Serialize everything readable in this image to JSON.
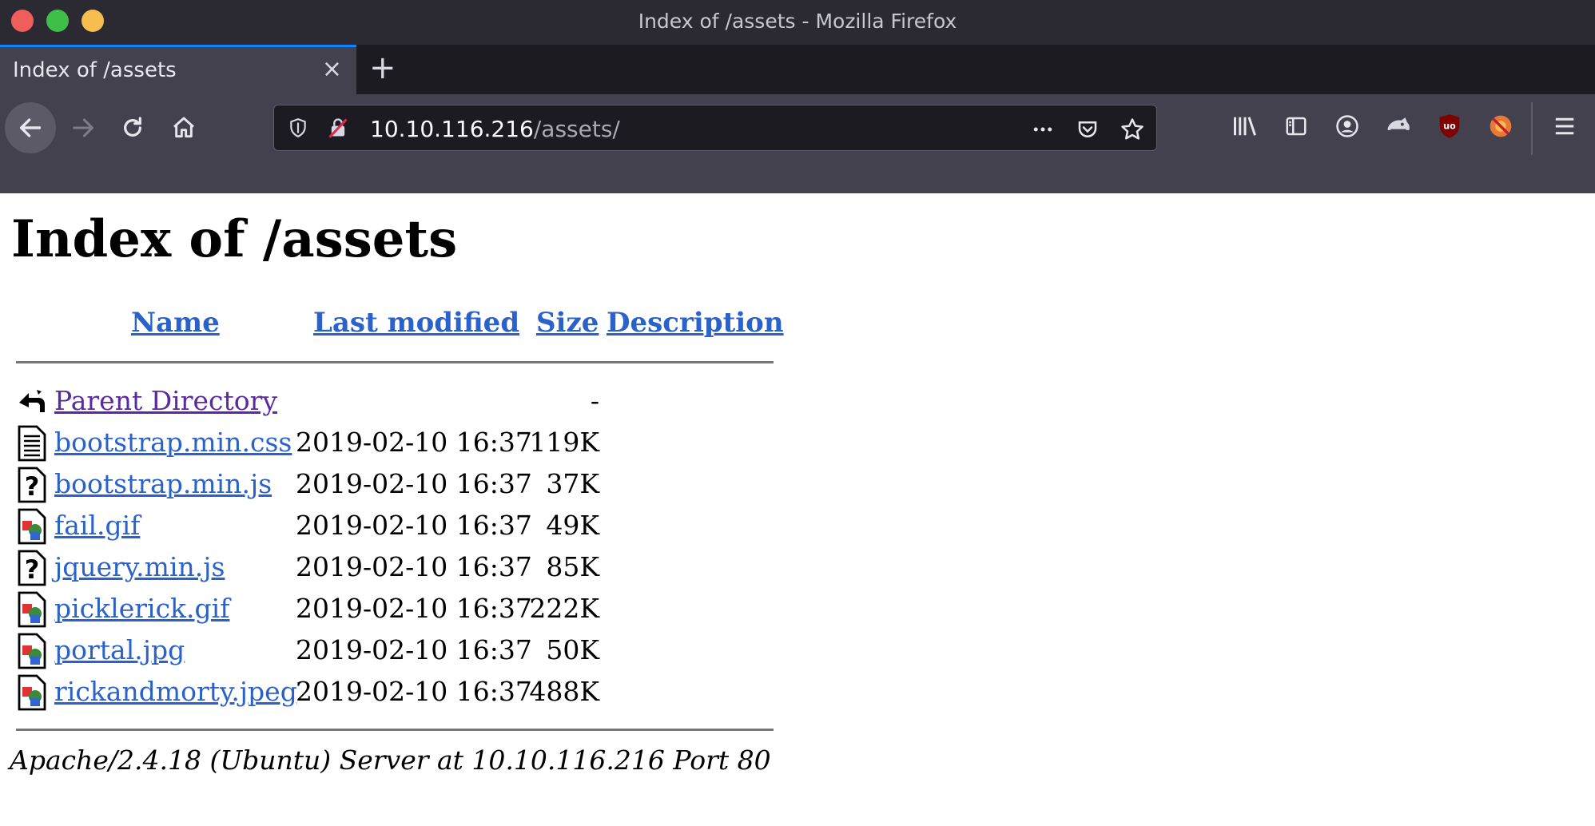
{
  "window": {
    "title": "Index of /assets - Mozilla Firefox"
  },
  "tab": {
    "title": "Index of /assets",
    "close": "×",
    "new_tab": "+"
  },
  "urlbar": {
    "host": "10.10.116.216",
    "path": "/assets/"
  },
  "page": {
    "heading": "Index of /assets",
    "columns": {
      "name": "Name",
      "last_modified": "Last modified",
      "size": "Size",
      "description": "Description"
    },
    "rows": [
      {
        "name": "Parent Directory",
        "date": "",
        "size": "-",
        "icon": "back-icon"
      },
      {
        "name": "bootstrap.min.css",
        "date": "2019-02-10 16:37",
        "size": "119K",
        "icon": "text-file-icon"
      },
      {
        "name": "bootstrap.min.js",
        "date": "2019-02-10 16:37",
        "size": "37K",
        "icon": "unknown-file-icon"
      },
      {
        "name": "fail.gif",
        "date": "2019-02-10 16:37",
        "size": "49K",
        "icon": "image-file-icon"
      },
      {
        "name": "jquery.min.js",
        "date": "2019-02-10 16:37",
        "size": "85K",
        "icon": "unknown-file-icon"
      },
      {
        "name": "picklerick.gif",
        "date": "2019-02-10 16:37",
        "size": "222K",
        "icon": "image-file-icon"
      },
      {
        "name": "portal.jpg",
        "date": "2019-02-10 16:37",
        "size": "50K",
        "icon": "image-file-icon"
      },
      {
        "name": "rickandmorty.jpeg",
        "date": "2019-02-10 16:37",
        "size": "488K",
        "icon": "image-file-icon"
      }
    ],
    "footer": "Apache/2.4.18 (Ubuntu) Server at 10.10.116.216 Port 80"
  }
}
